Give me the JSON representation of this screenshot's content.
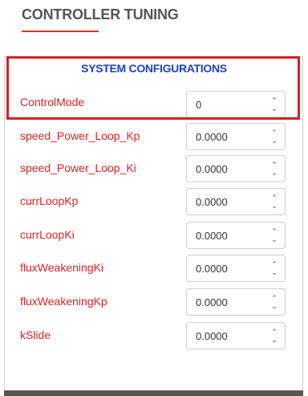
{
  "page": {
    "title": "CONTROLLER TUNING"
  },
  "panel": {
    "section_header": "SYSTEM CONFIGURATIONS"
  },
  "colors": {
    "label": "#e02020",
    "header": "#1f3fc6",
    "highlight": "#d61f1f",
    "title": "#555555"
  },
  "params": [
    {
      "label": "ControlMode",
      "value": "0"
    },
    {
      "label": "speed_Power_Loop_Kp",
      "value": "0.0000"
    },
    {
      "label": "speed_Power_Loop_Ki",
      "value": "0.0000"
    },
    {
      "label": "currLoopKp",
      "value": "0.0000"
    },
    {
      "label": "currLoopKi",
      "value": "0.0000"
    },
    {
      "label": "fluxWeakeningKi",
      "value": "0.0000"
    },
    {
      "label": "fluxWeakeningKp",
      "value": "0.0000"
    },
    {
      "label": "kSlide",
      "value": "0.0000"
    }
  ],
  "icons": {
    "spinner_up": "chevron-up-icon",
    "spinner_down": "chevron-down-icon"
  }
}
